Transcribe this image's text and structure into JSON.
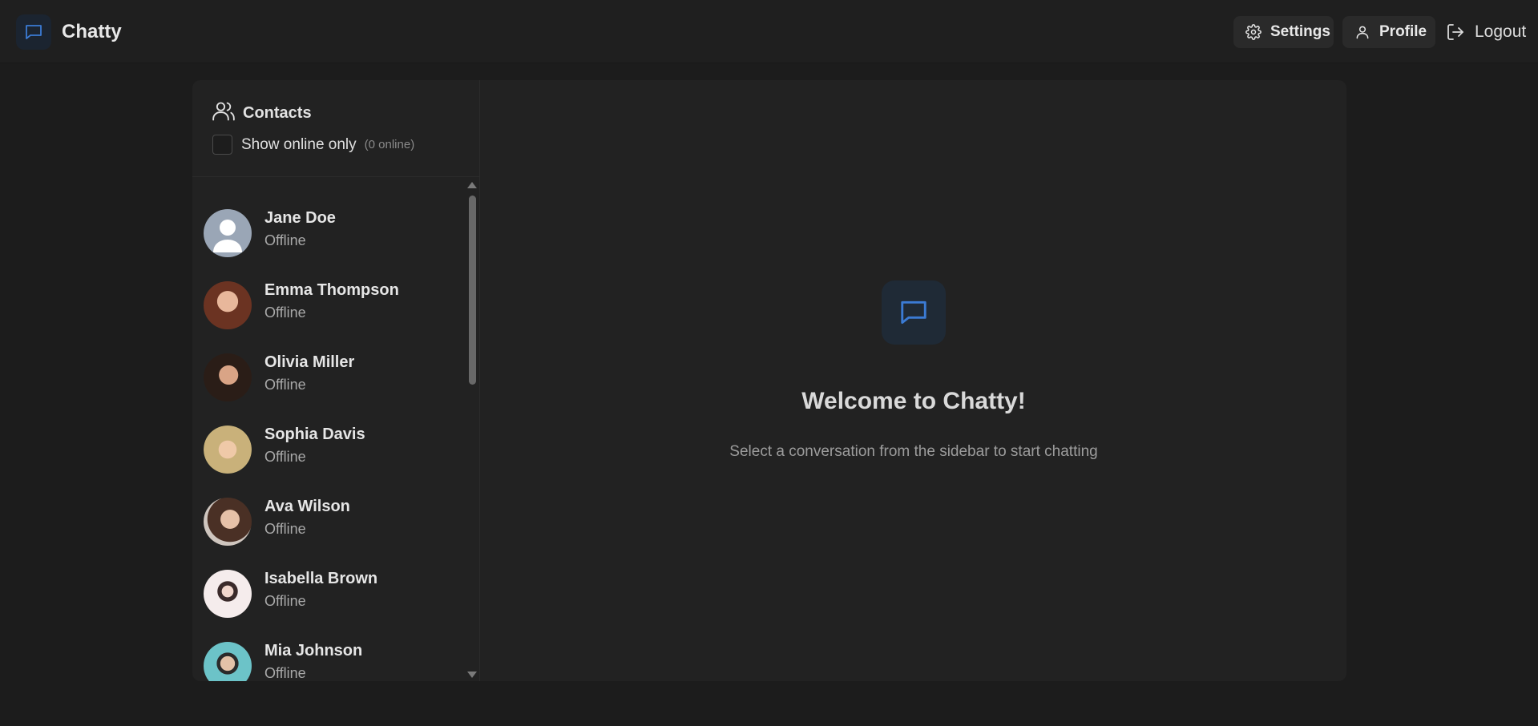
{
  "app": {
    "name": "Chatty",
    "accent": "#3b7bd4"
  },
  "header": {
    "settings_label": "Settings",
    "profile_label": "Profile",
    "logout_label": "Logout"
  },
  "sidebar": {
    "title": "Contacts",
    "online_filter_label": "Show online only",
    "online_count": "(0 online)",
    "online_filter_checked": false,
    "contacts": [
      {
        "name": "Jane Doe",
        "status": "Offline",
        "avatar": "default-avatar-icon"
      },
      {
        "name": "Emma Thompson",
        "status": "Offline",
        "avatar": "photo"
      },
      {
        "name": "Olivia Miller",
        "status": "Offline",
        "avatar": "photo"
      },
      {
        "name": "Sophia Davis",
        "status": "Offline",
        "avatar": "photo"
      },
      {
        "name": "Ava Wilson",
        "status": "Offline",
        "avatar": "photo"
      },
      {
        "name": "Isabella Brown",
        "status": "Offline",
        "avatar": "photo"
      },
      {
        "name": "Mia Johnson",
        "status": "Offline",
        "avatar": "photo"
      }
    ]
  },
  "main": {
    "welcome_title": "Welcome to Chatty!",
    "welcome_subtitle": "Select a conversation from the sidebar to start chatting"
  }
}
